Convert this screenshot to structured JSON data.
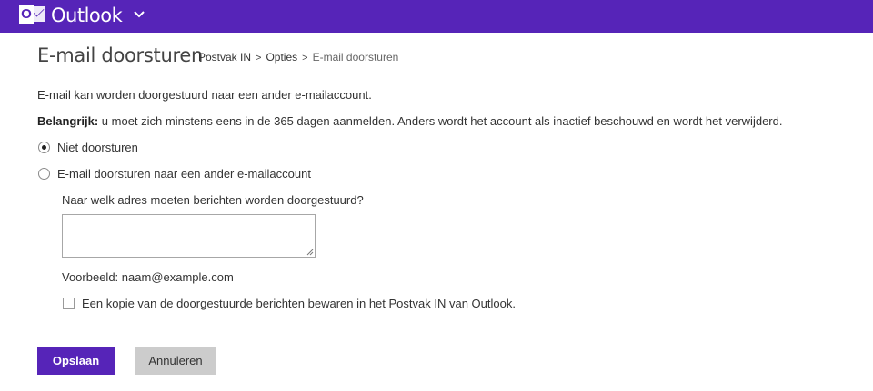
{
  "header": {
    "logo_letter": "O",
    "app_name": "Outlook",
    "brand_color": "#5624b8"
  },
  "page": {
    "title": "E-mail doorsturen",
    "breadcrumb": [
      "Postvak IN",
      "Opties",
      "E-mail doorsturen"
    ],
    "breadcrumb_separator": ">"
  },
  "content": {
    "intro": "E-mail kan worden doorgestuurd naar een ander e-mailaccount.",
    "important_label": "Belangrijk:",
    "important_text": " u moet zich minstens eens in de 365 dagen aanmelden. Anders wordt het account als inactief beschouwd en wordt het verwijderd.",
    "options": [
      {
        "label": "Niet doorsturen",
        "selected": true
      },
      {
        "label": "E-mail doorsturen naar een ander e-mailaccount",
        "selected": false
      }
    ],
    "address_question": "Naar welk adres moeten berichten worden doorgestuurd?",
    "address_value": "",
    "example": "Voorbeeld: naam@example.com",
    "keep_copy_label": "Een kopie van de doorgestuurde berichten bewaren in het Postvak IN van Outlook.",
    "keep_copy_checked": false
  },
  "actions": {
    "save_label": "Opslaan",
    "cancel_label": "Annuleren"
  }
}
